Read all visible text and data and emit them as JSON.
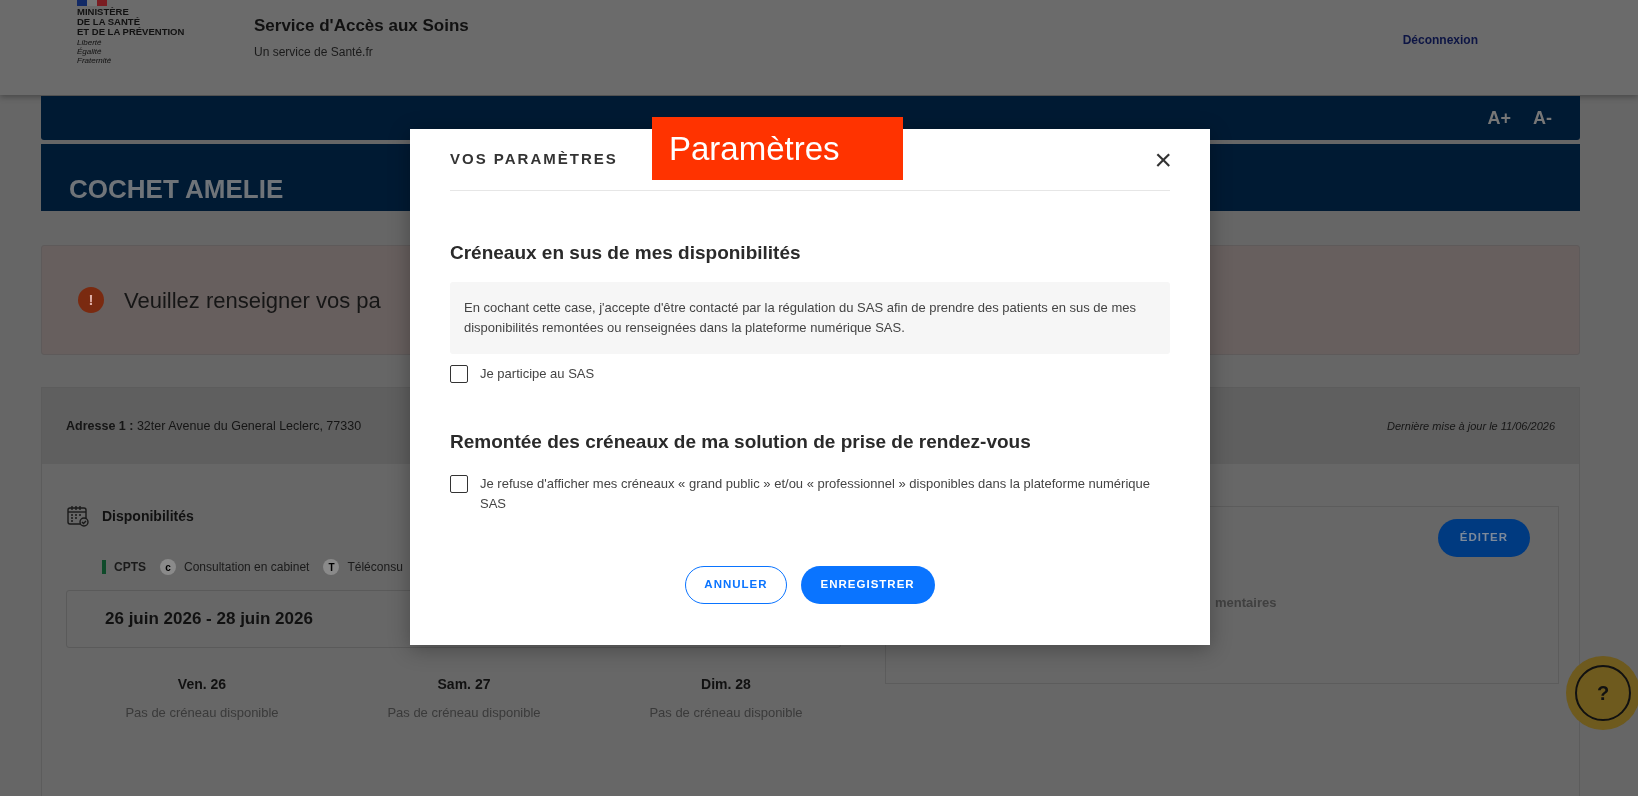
{
  "header": {
    "ministry": [
      "MINISTÈRE",
      "DE LA SANTÉ",
      "ET DE LA PRÉVENTION"
    ],
    "motto": [
      "Liberté",
      "Égalité",
      "Fraternité"
    ],
    "title": "Service d'Accès aux Soins",
    "subtitle": "Un service de Santé.fr",
    "logout": "Déconnexion"
  },
  "font_controls": [
    "A+",
    "A-"
  ],
  "profile_name": "COCHET AMELIE",
  "alert": {
    "icon": "!",
    "text": "Veuillez renseigner vos pa"
  },
  "address": {
    "label": "Adresse 1 :",
    "value": "32ter Avenue du General Leclerc, 77330",
    "updated": "Dernière mise à jour le 11/06/2026"
  },
  "availability": {
    "title": "Disponibilités",
    "legend": [
      {
        "kind": "bar",
        "label": "CPTS",
        "color": "#0f4a2a"
      },
      {
        "kind": "badge",
        "mark": "c",
        "label": "Consultation en cabinet"
      },
      {
        "kind": "badge",
        "mark": "T",
        "label": "Téléconsu"
      }
    ],
    "range": "26 juin 2026 - 28 juin 2026",
    "days": [
      {
        "day": "Ven. 26",
        "status": "Pas de créneau disponible"
      },
      {
        "day": "Sam. 27",
        "status": "Pas de créneau disponible"
      },
      {
        "day": "Dim. 28",
        "status": "Pas de créneau disponible"
      }
    ]
  },
  "side_panel": {
    "edit_button": "ÉDITER",
    "partial_text": "mentaires"
  },
  "help_button": "?",
  "annotation": "Paramètres",
  "modal": {
    "title": "VOS PARAMÈTRES",
    "close": "×",
    "sections": [
      {
        "heading": "Créneaux en sus de mes disponibilités",
        "info": "En cochant cette case, j'accepte d'être contacté par la régulation du SAS afin de prendre des patients en sus de mes disponibilités remontées ou renseignées dans la plateforme numérique SAS.",
        "checkbox": {
          "label": "Je participe au SAS",
          "checked": false
        }
      },
      {
        "heading": "Remontée des créneaux de ma solution de prise de rendez-vous",
        "checkbox": {
          "label": "Je refuse d'afficher mes créneaux « grand public » et/ou « professionnel » disponibles dans la plateforme numérique SAS",
          "checked": false
        }
      }
    ],
    "buttons": [
      {
        "label": "ANNULER",
        "kind": "secondary"
      },
      {
        "label": "ENREGISTRER",
        "kind": "primary"
      }
    ]
  }
}
